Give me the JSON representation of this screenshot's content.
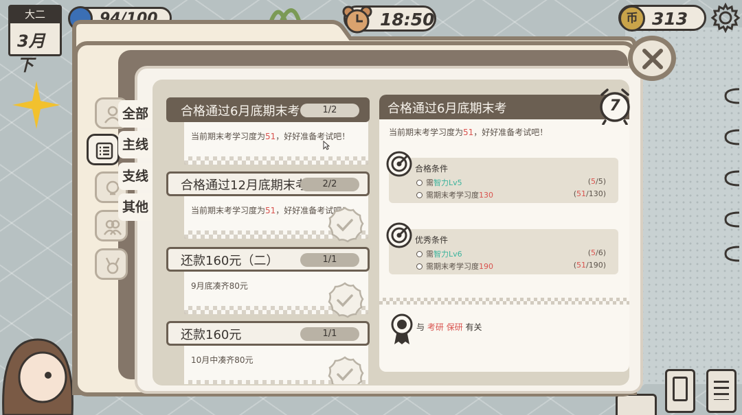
{
  "hud": {
    "grade": "大二",
    "month": "3月下",
    "stamina": "94/100",
    "time": "18:50",
    "coins": "313",
    "coin_icon_char": "币"
  },
  "tabs": [
    {
      "label": "全部",
      "icon": "person-icon"
    },
    {
      "label": "主线",
      "icon": "list-icon"
    },
    {
      "label": "支线",
      "icon": "bulb-icon"
    },
    {
      "label": "其他",
      "icon": "people-icon"
    }
  ],
  "medal_tab_icon": "medal-icon",
  "quests": [
    {
      "title": "合格通过6月底期末考",
      "progress": "1/2",
      "desc_pre": "当前期末考学习度为",
      "desc_num": "51",
      "desc_post": "，好好准备考试吧！",
      "selected": true,
      "done": false
    },
    {
      "title": "合格通过12月底期末考",
      "progress": "2/2",
      "desc_pre": "当前期末考学习度为",
      "desc_num": "51",
      "desc_post": "，好好准备考试吧！",
      "selected": false,
      "done": true
    },
    {
      "title": "还款160元（二）",
      "progress": "1/1",
      "desc": "9月底凑齐80元",
      "selected": false,
      "done": true
    },
    {
      "title": "还款160元",
      "progress": "1/1",
      "desc": "10月中凑齐80元",
      "selected": false,
      "done": true
    }
  ],
  "detail": {
    "title": "合格通过6月底期末考",
    "timer": "7",
    "desc_pre": "当前期末考学习度为",
    "desc_num": "51",
    "desc_post": "，好好准备考试吧！",
    "pass": {
      "title": "合格条件",
      "rows": [
        {
          "pre": "需",
          "key": "智力Lv5",
          "value_a": "5",
          "value_b": "/5)",
          "open": "("
        },
        {
          "pre": "需期末考学习度",
          "key": "130",
          "value_a": "51",
          "value_b": "/130)",
          "open": "("
        }
      ]
    },
    "excellent": {
      "title": "优秀条件",
      "rows": [
        {
          "pre": "需",
          "key": "智力Lv6",
          "value_a": "5",
          "value_b": "/6)",
          "open": "("
        },
        {
          "pre": "需期末考学习度",
          "key": "190",
          "value_a": "51",
          "value_b": "/190)",
          "open": "("
        }
      ]
    },
    "related": {
      "pre": "与",
      "tag1": "考研",
      "tag2": "保研",
      "post": "有关"
    }
  },
  "colors": {
    "accent_dark": "#6b5f52",
    "highlight_red": "#d9534f",
    "highlight_teal": "#3bb39c",
    "paper": "#f4ecdc"
  }
}
